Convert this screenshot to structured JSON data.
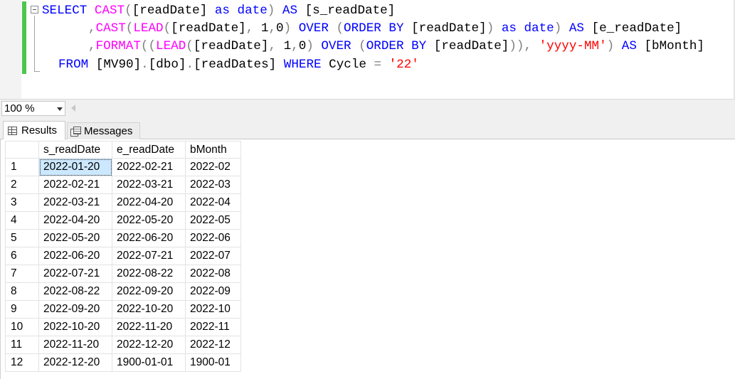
{
  "editor": {
    "lines": [
      [
        {
          "t": "SELECT ",
          "c": "kw"
        },
        {
          "t": "CAST",
          "c": "fn"
        },
        {
          "t": "(",
          "c": "op"
        },
        {
          "t": "[readDate] ",
          "c": ""
        },
        {
          "t": "as ",
          "c": "kw"
        },
        {
          "t": "date",
          "c": "kw"
        },
        {
          "t": ") ",
          "c": "op"
        },
        {
          "t": "AS ",
          "c": "kw"
        },
        {
          "t": "[s_readDate]",
          "c": ""
        }
      ],
      [
        {
          "t": ",",
          "c": "op"
        },
        {
          "t": "CAST",
          "c": "fn"
        },
        {
          "t": "(",
          "c": "op"
        },
        {
          "t": "LEAD",
          "c": "fn"
        },
        {
          "t": "(",
          "c": "op"
        },
        {
          "t": "[readDate]",
          "c": ""
        },
        {
          "t": ", ",
          "c": "op"
        },
        {
          "t": "1",
          "c": ""
        },
        {
          "t": ",",
          "c": "op"
        },
        {
          "t": "0",
          "c": ""
        },
        {
          "t": ") ",
          "c": "op"
        },
        {
          "t": "OVER ",
          "c": "kw"
        },
        {
          "t": "(",
          "c": "op"
        },
        {
          "t": "ORDER ",
          "c": "kw"
        },
        {
          "t": "BY ",
          "c": "kw"
        },
        {
          "t": "[readDate]",
          "c": ""
        },
        {
          "t": ") ",
          "c": "op"
        },
        {
          "t": "as ",
          "c": "kw"
        },
        {
          "t": "date",
          "c": "kw"
        },
        {
          "t": ") ",
          "c": "op"
        },
        {
          "t": "AS ",
          "c": "kw"
        },
        {
          "t": "[e_readDate]",
          "c": ""
        }
      ],
      [
        {
          "t": ",",
          "c": "op"
        },
        {
          "t": "FORMAT",
          "c": "fn"
        },
        {
          "t": "((",
          "c": "op"
        },
        {
          "t": "LEAD",
          "c": "fn"
        },
        {
          "t": "(",
          "c": "op"
        },
        {
          "t": "[readDate]",
          "c": ""
        },
        {
          "t": ", ",
          "c": "op"
        },
        {
          "t": "1",
          "c": ""
        },
        {
          "t": ",",
          "c": "op"
        },
        {
          "t": "0",
          "c": ""
        },
        {
          "t": ") ",
          "c": "op"
        },
        {
          "t": "OVER ",
          "c": "kw"
        },
        {
          "t": "(",
          "c": "op"
        },
        {
          "t": "ORDER ",
          "c": "kw"
        },
        {
          "t": "BY ",
          "c": "kw"
        },
        {
          "t": "[readDate]",
          "c": ""
        },
        {
          "t": "))",
          "c": "op"
        },
        {
          "t": ", ",
          "c": "op"
        },
        {
          "t": "'yyyy-MM'",
          "c": "str"
        },
        {
          "t": ") ",
          "c": "op"
        },
        {
          "t": "AS ",
          "c": "kw"
        },
        {
          "t": "[bMonth]",
          "c": ""
        }
      ],
      [
        {
          "t": "FROM ",
          "c": "kw"
        },
        {
          "t": "[MV90]",
          "c": ""
        },
        {
          "t": ".",
          "c": "op"
        },
        {
          "t": "[dbo]",
          "c": ""
        },
        {
          "t": ".",
          "c": "op"
        },
        {
          "t": "[readDates] ",
          "c": ""
        },
        {
          "t": "WHERE ",
          "c": "kw"
        },
        {
          "t": "Cycle ",
          "c": ""
        },
        {
          "t": "= ",
          "c": "op"
        },
        {
          "t": "'22'",
          "c": "str"
        }
      ]
    ]
  },
  "zoom": {
    "value": "100 %"
  },
  "tabs": {
    "results": "Results",
    "messages": "Messages"
  },
  "grid": {
    "columns": [
      "s_readDate",
      "e_readDate",
      "bMonth"
    ],
    "rows": [
      {
        "n": "1",
        "s": "2022-01-20",
        "e": "2022-02-21",
        "b": "2022-02"
      },
      {
        "n": "2",
        "s": "2022-02-21",
        "e": "2022-03-21",
        "b": "2022-03"
      },
      {
        "n": "3",
        "s": "2022-03-21",
        "e": "2022-04-20",
        "b": "2022-04"
      },
      {
        "n": "4",
        "s": "2022-04-20",
        "e": "2022-05-20",
        "b": "2022-05"
      },
      {
        "n": "5",
        "s": "2022-05-20",
        "e": "2022-06-20",
        "b": "2022-06"
      },
      {
        "n": "6",
        "s": "2022-06-20",
        "e": "2022-07-21",
        "b": "2022-07"
      },
      {
        "n": "7",
        "s": "2022-07-21",
        "e": "2022-08-22",
        "b": "2022-08"
      },
      {
        "n": "8",
        "s": "2022-08-22",
        "e": "2022-09-20",
        "b": "2022-09"
      },
      {
        "n": "9",
        "s": "2022-09-20",
        "e": "2022-10-20",
        "b": "2022-10"
      },
      {
        "n": "10",
        "s": "2022-10-20",
        "e": "2022-11-20",
        "b": "2022-11"
      },
      {
        "n": "11",
        "s": "2022-11-20",
        "e": "2022-12-20",
        "b": "2022-12"
      },
      {
        "n": "12",
        "s": "2022-12-20",
        "e": "1900-01-01",
        "b": "1900-01"
      }
    ]
  },
  "colors": {
    "keyword": "#0000ff",
    "function": "#ff00ff",
    "string": "#ff0000",
    "operator": "#808080",
    "change_bar": "#4cc74c",
    "selection": "#cce8ff"
  },
  "icons": {
    "collapse": "collapse-box-icon",
    "results": "grid-icon",
    "messages": "messages-icon"
  }
}
